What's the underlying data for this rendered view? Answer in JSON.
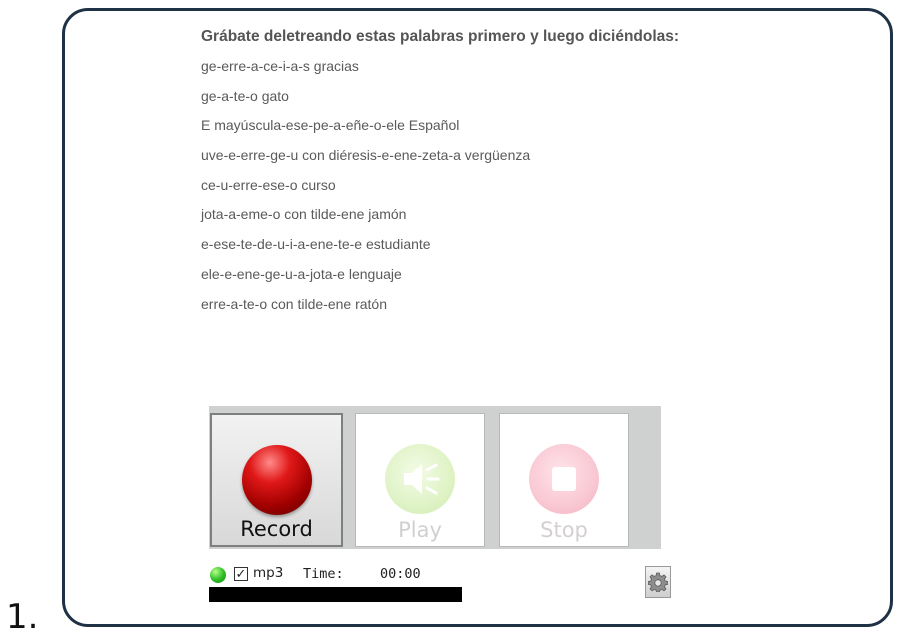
{
  "item_number": "1.",
  "instructions": {
    "heading": "Grábate deletreando estas palabras primero y luego diciéndolas:",
    "lines": [
      "ge-erre-a-ce-i-a-s gracias",
      "ge-a-te-o gato",
      "E mayúscula-ese-pe-a-eñe-o-ele Español",
      "uve-e-erre-ge-u con diéresis-e-ene-zeta-a vergüenza",
      "ce-u-erre-ese-o curso",
      "jota-a-eme-o  con tilde-ene jamón",
      "e-ese-te-de-u-i-a-ene-te-e estudiante",
      "ele-e-ene-ge-u-a-jota-e lenguaje",
      "erre-a-te-o con tilde-ene ratón"
    ]
  },
  "recorder": {
    "record_label": "Record",
    "play_label": "Play",
    "stop_label": "Stop",
    "record_icon": "record-icon",
    "play_icon": "speaker-icon",
    "stop_icon": "stop-icon"
  },
  "status": {
    "format_label": "mp3",
    "format_checked": true,
    "time_label": "Time:",
    "time_value": "00:00",
    "progress_fraction": 0,
    "led_color": "#33c22a",
    "settings_icon": "gear-icon"
  },
  "colors": {
    "frame_border": "#1e3145",
    "record_red": "#c41010",
    "play_green": "#dff3c6",
    "stop_pink": "#f9c8d3"
  }
}
